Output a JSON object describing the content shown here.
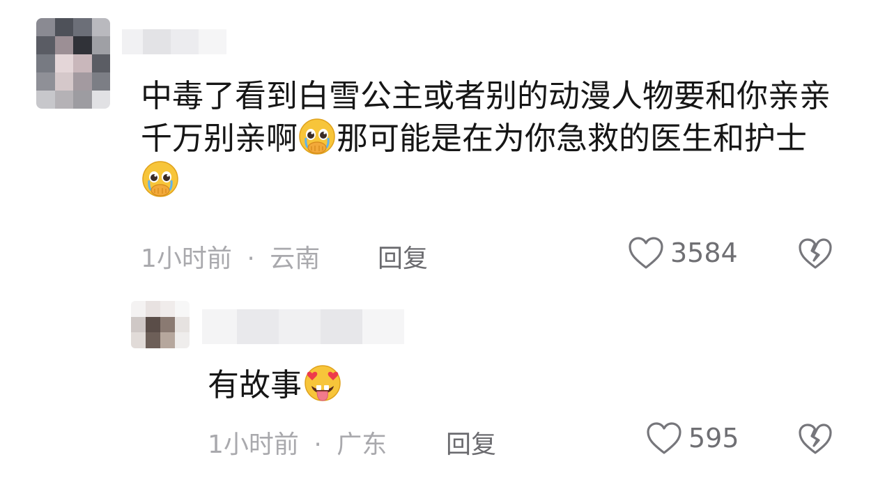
{
  "comments": [
    {
      "text_part1": "中毒了看到白雪公主或者别的动漫人物要和你亲亲千万别亲啊",
      "emoji1": "pleading-face-crying-emoji",
      "text_part2": "那可能是在为你急救的医生和护士",
      "emoji2": "pleading-face-crying-emoji",
      "time": "1小时前",
      "separator": "·",
      "location": "云南",
      "reply_label": "回复",
      "like_count": "3584",
      "like_icon": "heart-outline-icon",
      "dislike_icon": "broken-heart-icon"
    },
    {
      "text": "有故事",
      "emoji": "heart-eyes-tongue-emoji",
      "time": "1小时前",
      "separator": "·",
      "location": "广东",
      "reply_label": "回复",
      "like_count": "595",
      "like_icon": "heart-outline-icon",
      "dislike_icon": "broken-heart-icon"
    }
  ],
  "colors": {
    "meta_text": "#a9a9ad",
    "action_text": "#6b6b6f",
    "body_text": "#161616"
  }
}
